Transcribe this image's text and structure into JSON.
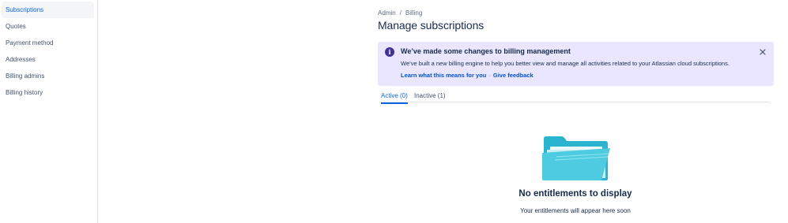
{
  "sidebar": {
    "items": [
      {
        "label": "Subscriptions",
        "active": true
      },
      {
        "label": "Quotes"
      },
      {
        "label": "Payment method"
      },
      {
        "label": "Addresses"
      },
      {
        "label": "Billing admins"
      },
      {
        "label": "Billing history"
      }
    ]
  },
  "breadcrumb": {
    "items": [
      "Admin",
      "Billing"
    ],
    "separator": "/"
  },
  "page": {
    "title": "Manage subscriptions"
  },
  "banner": {
    "icon": "info-icon",
    "icon_glyph": "i",
    "title": "We’ve made some changes to billing management",
    "body": "We’ve built a new billing engine to help you better view and manage all activities related to your Atlassian cloud subscriptions.",
    "links": [
      "Learn what this means for you",
      "Give feedback"
    ],
    "link_separator": "·",
    "close_icon": "close-icon",
    "background_color": "#eae6ff",
    "icon_color": "#403294"
  },
  "tabs": [
    {
      "label": "Active (0)",
      "selected": true
    },
    {
      "label": "Inactive (1)",
      "selected": false
    }
  ],
  "empty_state": {
    "illustration": "folder-icon",
    "title": "No entitlements to display",
    "subtitle": "Your entitlements will appear here soon"
  },
  "colors": {
    "accent": "#0c66e4",
    "link": "#0052cc",
    "text": "#172b4d",
    "muted": "#42526e"
  }
}
